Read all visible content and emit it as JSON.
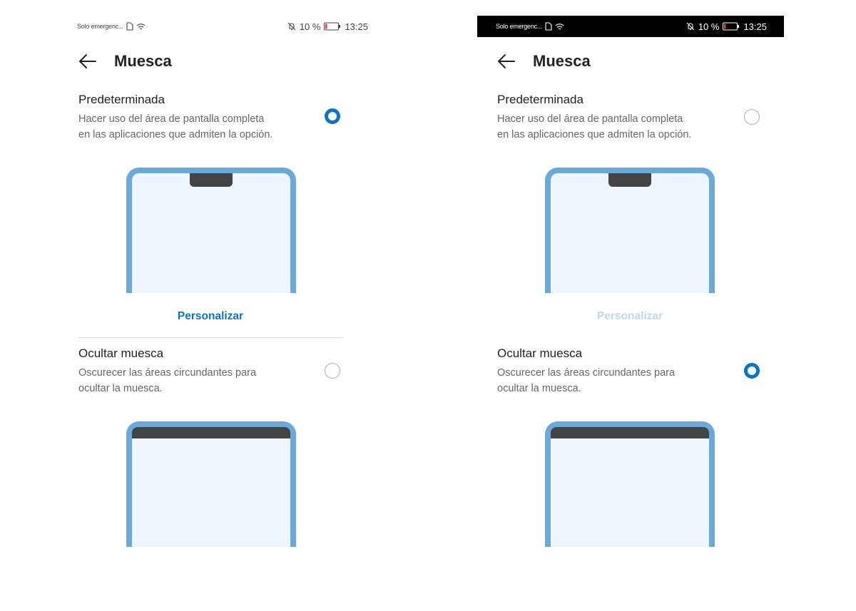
{
  "colors": {
    "accent": "#0a74c8",
    "accent_disabled": "#bcd9ef",
    "phone_frame": "#6aa9d8",
    "phone_screen": "#eef6fd",
    "notch": "#444444",
    "status_bar_dark": "#000000"
  },
  "screens": [
    {
      "status": {
        "carrier": "Solo emergenc...",
        "battery": "10 %",
        "time": "13:25"
      },
      "title": "Muesca",
      "option_default": {
        "title": "Predeterminada",
        "desc_line1": "Hacer uso del área de pantalla completa",
        "desc_line2": "en las aplicaciones que admiten la opción.",
        "selected": true
      },
      "personalize_label": "Personalizar",
      "personalize_enabled": true,
      "option_hide": {
        "title": "Ocultar muesca",
        "desc_line1": "Oscurecer las áreas circundantes para",
        "desc_line2": "ocultar la muesca.",
        "selected": false
      }
    },
    {
      "status": {
        "carrier": "Solo emergenc...",
        "battery": "10 %",
        "time": "13:25"
      },
      "title": "Muesca",
      "option_default": {
        "title": "Predeterminada",
        "desc_line1": "Hacer uso del área de pantalla completa",
        "desc_line2": "en las aplicaciones que admiten la opción.",
        "selected": false
      },
      "personalize_label": "Personalizar",
      "personalize_enabled": false,
      "option_hide": {
        "title": "Ocultar muesca",
        "desc_line1": "Oscurecer las áreas circundantes para",
        "desc_line2": "ocultar la muesca.",
        "selected": true
      }
    }
  ]
}
